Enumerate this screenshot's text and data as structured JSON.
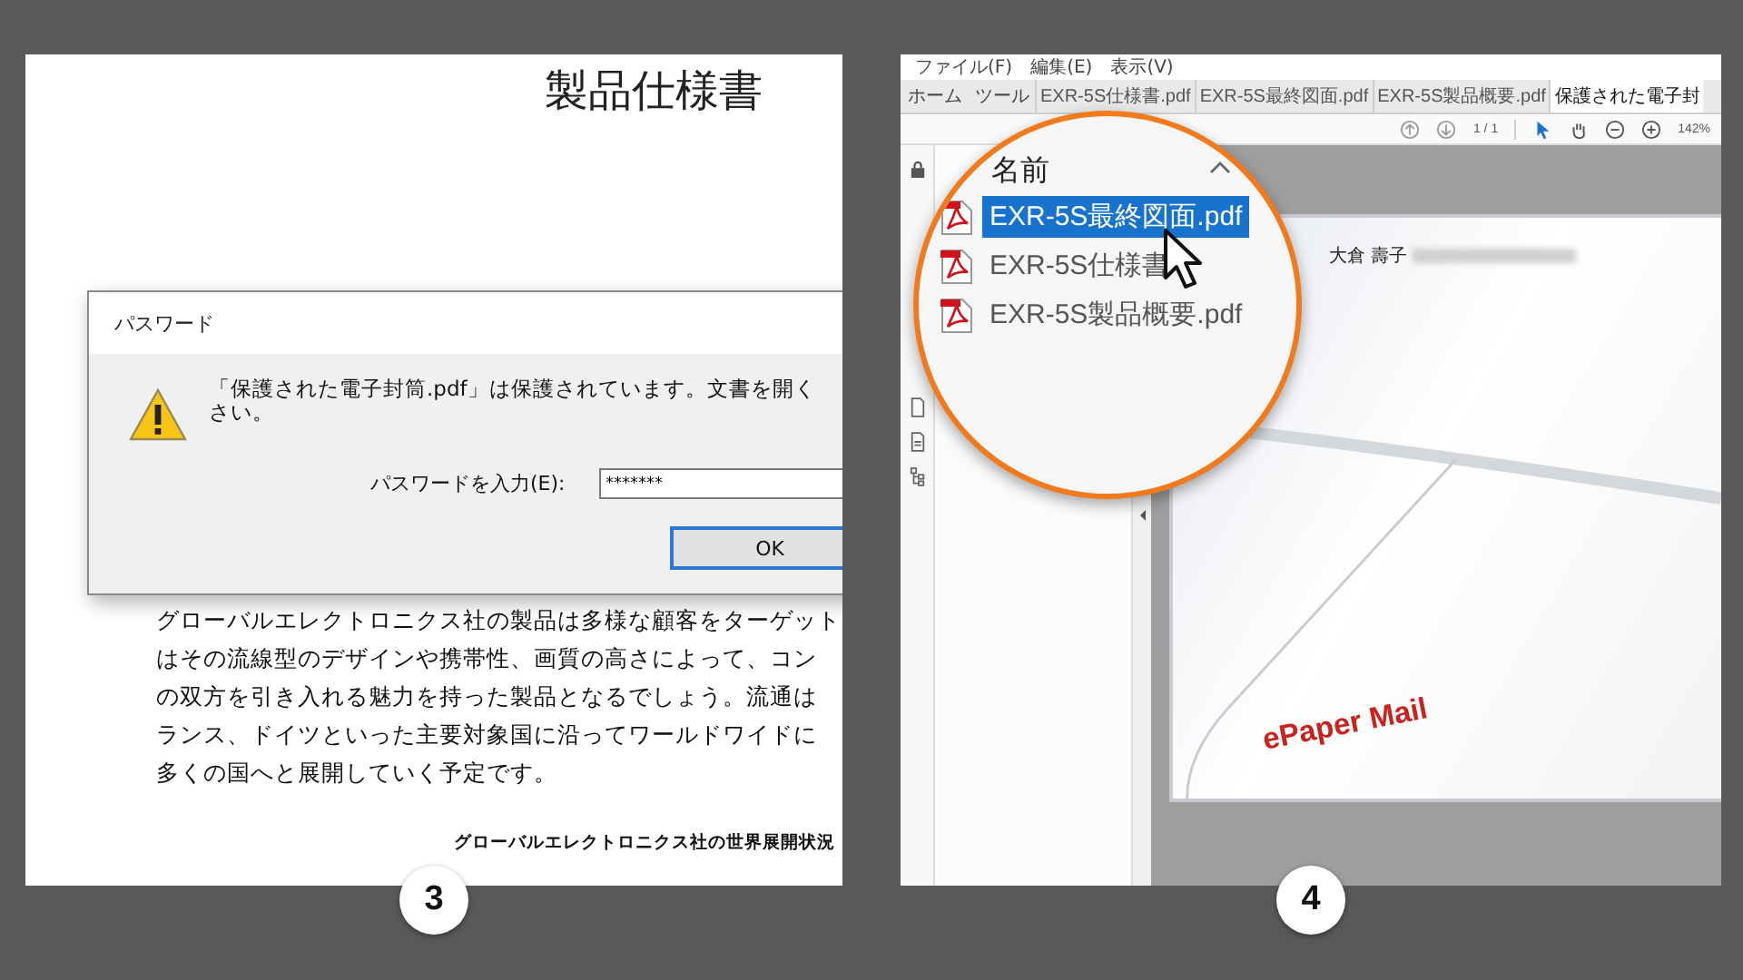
{
  "password_screen": {
    "step": "3",
    "document": {
      "title": "製品仕様書",
      "paragraph_lines": [
        "グローバルエレクトロニクス社の製品は多様な顧客をターゲット",
        "はその流線型のデザインや携帯性、画質の高さによって、コン",
        "の双方を引き入れる魅力を持った製品となるでしょう。流通は",
        "ランス、ドイツといった主要対象国に沿ってワールドワイドに",
        "多くの国へと展開していく予定です。"
      ],
      "caption": "グローバルエレクトロニクス社の世界展開状況"
    },
    "dialog": {
      "title": "パスワード",
      "message_lines": [
        "「保護された電子封筒.pdf」は保護されています。文書を開く",
        "さい。"
      ],
      "field_label": "パスワードを入力(E):",
      "field_value": "*******",
      "ok_button": "OK"
    }
  },
  "reader_screen": {
    "step": "4",
    "menu": [
      "ファイル(F)",
      "編集(E)",
      "表示(V)"
    ],
    "nav_tabs": [
      {
        "label": "ホーム",
        "selected": false
      },
      {
        "label": "ツール",
        "selected": false
      }
    ],
    "file_tabs": [
      {
        "label": "EXR-5S仕様書.pdf",
        "selected": false
      },
      {
        "label": "EXR-5S最終図面.pdf",
        "selected": false
      },
      {
        "label": "EXR-5S製品概要.pdf",
        "selected": false
      },
      {
        "label": "保護された電子封",
        "selected": true
      }
    ],
    "page_indicator": "1 / 1",
    "zoom": "142%",
    "attachments": {
      "header": "名前",
      "files": [
        {
          "name": "EXR-5S最終図面.pdf",
          "selected": true
        },
        {
          "name": "EXR-5S仕様書",
          "selected": false
        },
        {
          "name": "EXR-5S製品概要.pdf",
          "selected": false
        }
      ]
    },
    "page": {
      "recipient": "大倉 壽子",
      "brand": "ePaper Mail"
    }
  }
}
